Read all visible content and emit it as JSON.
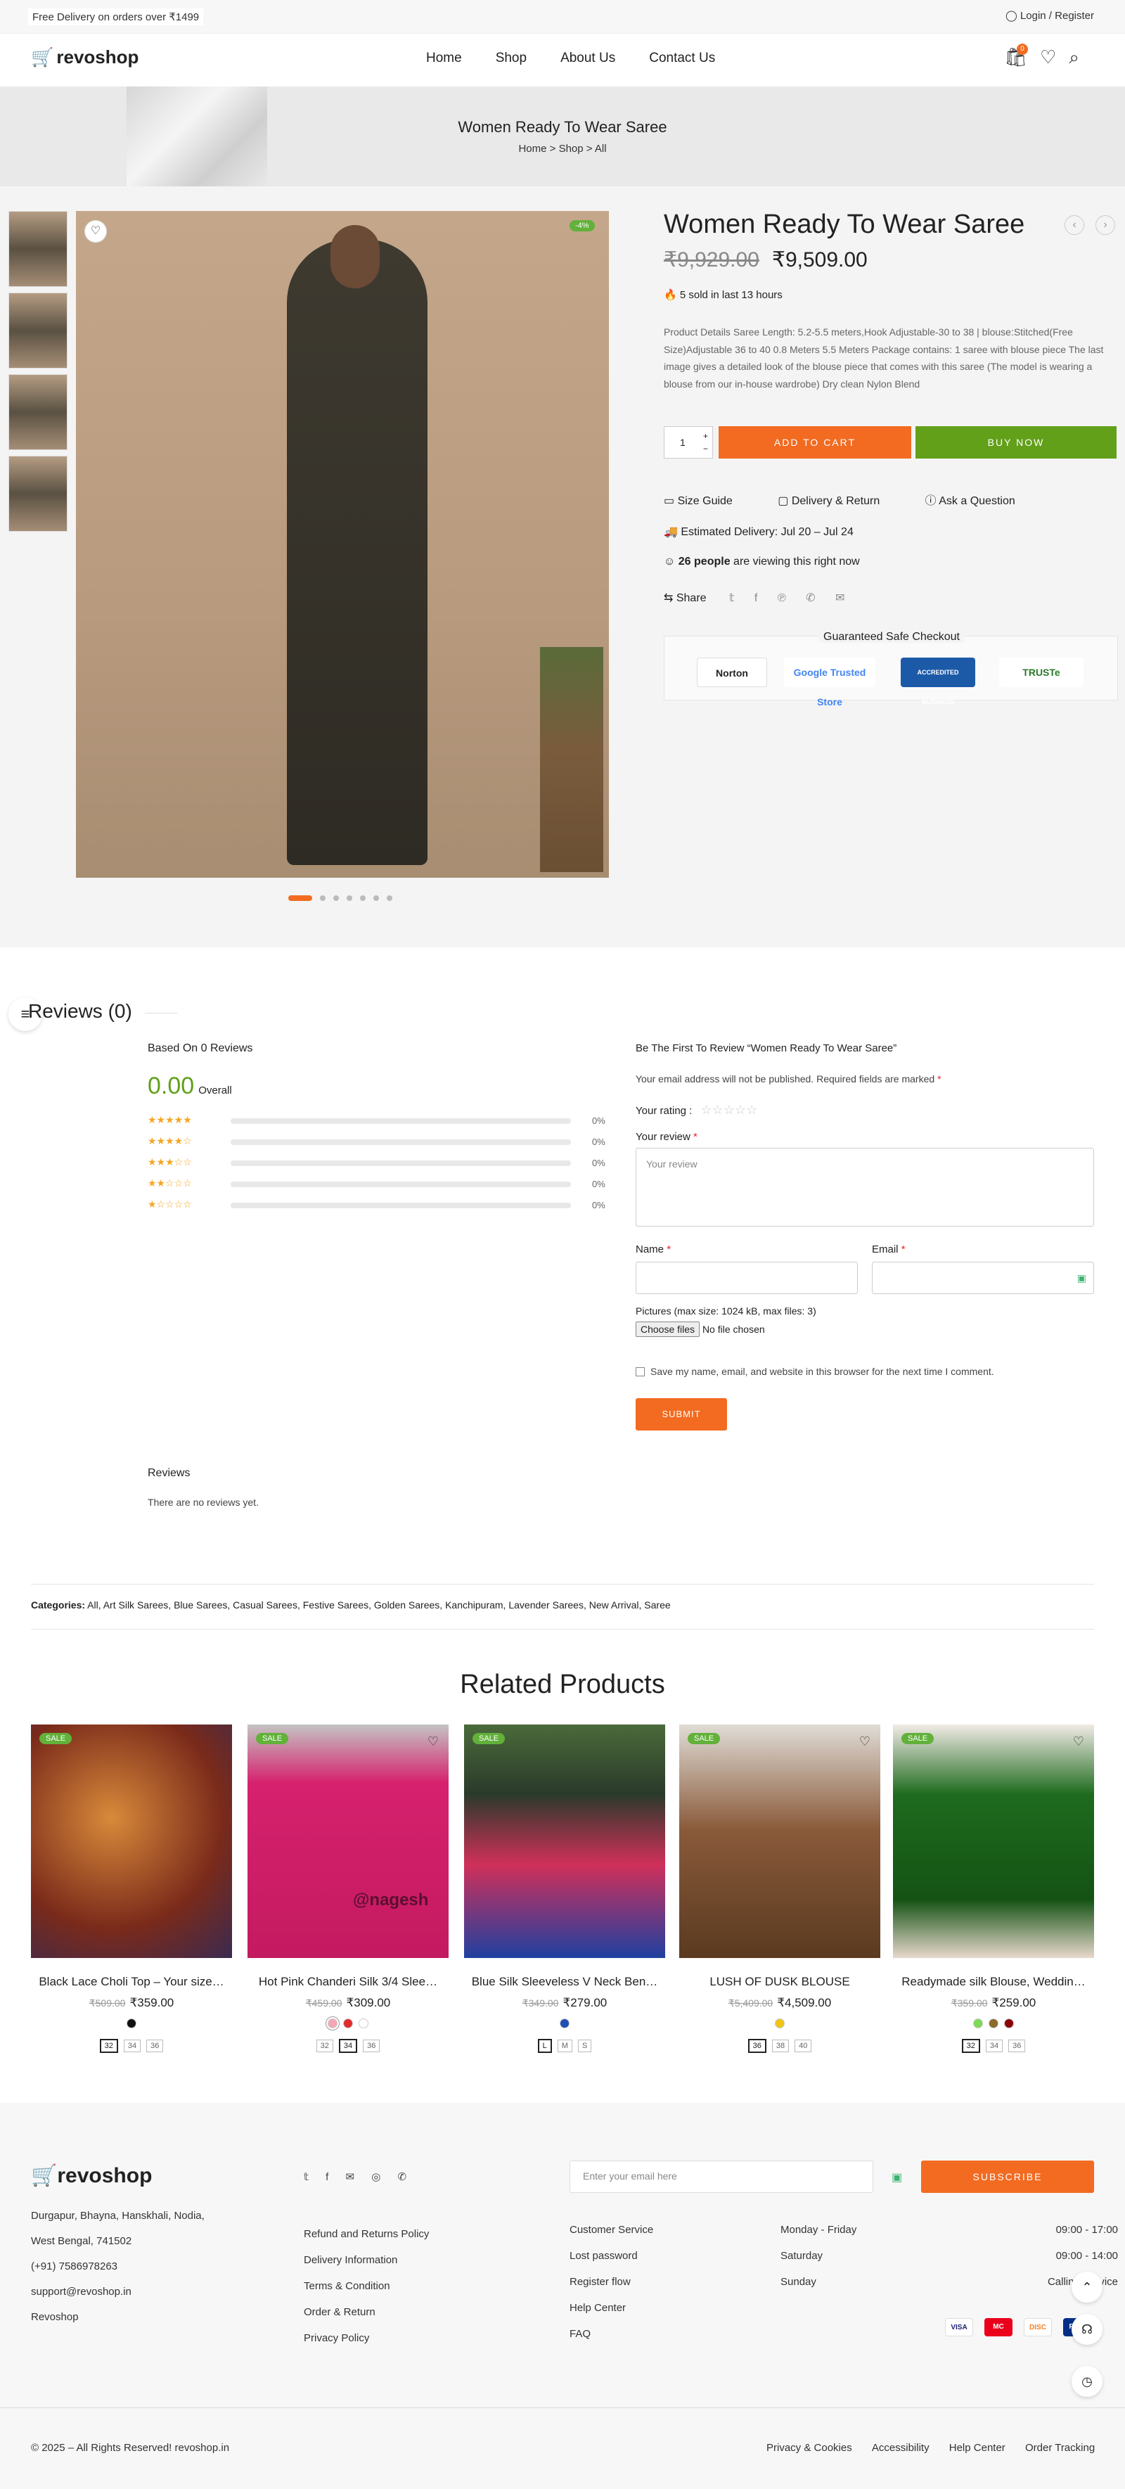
{
  "topbar": {
    "promo": "Free Delivery on orders over ₹1499",
    "login": "Login / Register"
  },
  "header": {
    "logo": "revoshop",
    "nav": [
      "Home",
      "Shop",
      "About Us",
      "Contact Us"
    ],
    "cart_count": "0",
    "icons": [
      "cart-icon",
      "heart-icon",
      "search-icon"
    ]
  },
  "banner": {
    "title": "Women Ready To Wear Saree",
    "crumbs": [
      "Home",
      ">",
      "Shop",
      ">",
      "All"
    ]
  },
  "product": {
    "discount": "-4%",
    "title": "Women Ready To Wear Saree",
    "old_price": "₹9,929.00",
    "price": "₹9,509.00",
    "sold": "5 sold in last 13 hours",
    "description": "Product Details Saree Length: 5.2-5.5 meters,Hook Adjustable-30 to 38 | blouse:Stitched(Free Size)Adjustable 36 to 40 0.8 Meters 5.5 Meters Package contains: 1 saree with blouse piece The last image gives a detailed look of the blouse piece that comes with this saree (The model is wearing a blouse from our in-house wardrobe) Dry clean Nylon Blend",
    "qty": "1",
    "add_to_cart": "ADD TO CART",
    "buy_now": "BUY NOW",
    "links": [
      "Size Guide",
      "Delivery & Return",
      "Ask a Question"
    ],
    "delivery_label": "Estimated Delivery:",
    "delivery_value": "Jul 20 – Jul 24",
    "viewing_count": "26 people",
    "viewing_text": "are viewing this right now",
    "share": "Share",
    "safe_checkout": "Guaranteed Safe Checkout",
    "trust_badges": [
      "Norton",
      "Google Trusted Store",
      "ACCREDITED BUSINESS",
      "TRUSTe"
    ]
  },
  "reviews": {
    "title": "Reviews (0)",
    "based_on": "Based On 0 Reviews",
    "average": "0.00",
    "overall": "Overall",
    "stars": [
      "★★★★★",
      "★★★★☆",
      "★★★☆☆",
      "★★☆☆☆",
      "★☆☆☆☆"
    ],
    "percents": [
      "0%",
      "0%",
      "0%",
      "0%",
      "0%"
    ],
    "form_title": "Be The First To Review “Women Ready To Wear Saree”",
    "notice": "Your email address will not be published. Required fields are marked",
    "rating_label": "Your rating :",
    "rating_stars": "☆☆☆☆☆",
    "review_label": "Your review",
    "review_placeholder": "Your review",
    "name_label": "Name",
    "email_label": "Email",
    "pictures_label": "Pictures (max size: 1024 kB, max files: 3)",
    "choose_files": "Choose files",
    "no_file": "No file chosen",
    "save_info": "Save my name, email, and website in this browser for the next time I comment.",
    "submit": "SUBMIT",
    "list_title": "Reviews",
    "empty": "There are no reviews yet."
  },
  "categories": {
    "label": "Categories:",
    "list": "All, Art Silk Sarees, Blue Sarees, Casual Sarees, Festive Sarees, Golden Sarees, Kanchipuram, Lavender Sarees, New Arrival, Saree"
  },
  "related": {
    "title": "Related Products",
    "items": [
      {
        "name": "Black Lace Choli Top – Your size…",
        "old": "₹509.00",
        "price": "₹359.00",
        "sale": "SALE",
        "sizes": [
          "32",
          "34",
          "36"
        ],
        "sel": 0,
        "swatches": [
          "#111111"
        ]
      },
      {
        "name": "Hot Pink Chanderi Silk 3/4 Slee…",
        "old": "₹459.00",
        "price": "₹309.00",
        "sale": "SALE",
        "sizes": [
          "32",
          "34",
          "36"
        ],
        "sel": 1,
        "swatches": [
          "#f4a6b8",
          "#e02c2c",
          "#ffffff"
        ],
        "watermark": "@nagesh"
      },
      {
        "name": "Blue Silk Sleeveless V Neck Ben…",
        "old": "₹349.00",
        "price": "₹279.00",
        "sale": "SALE",
        "sizes": [
          "L",
          "M",
          "S"
        ],
        "sel": 0,
        "swatches": [
          "#1f4fb5"
        ]
      },
      {
        "name": "LUSH OF DUSK BLOUSE",
        "old": "₹5,409.00",
        "price": "₹4,509.00",
        "sale": "SALE",
        "sizes": [
          "36",
          "38",
          "40"
        ],
        "sel": 0,
        "swatches": [
          "#f0c419"
        ]
      },
      {
        "name": "Readymade silk Blouse, Weddin…",
        "old": "₹359.00",
        "price": "₹259.00",
        "sale": "SALE",
        "sizes": [
          "32",
          "34",
          "36"
        ],
        "sel": 0,
        "swatches": [
          "#7ed957",
          "#8b6a2a",
          "#8b0000"
        ]
      }
    ]
  },
  "footer": {
    "logo": "revoshop",
    "address1": "Durgapur, Bhayna, Hanskhali, Nodia,",
    "address2": "West Bengal, 741502",
    "phone": "(+91) 7586978263",
    "email": "support@revoshop.in",
    "brand": "Revoshop",
    "policies": [
      "Refund and Returns Policy",
      "Delivery Information",
      "Terms & Condition",
      "Order & Return",
      "Privacy Policy"
    ],
    "service": [
      "Customer Service",
      "Lost password",
      "Register flow",
      "Help Center",
      "FAQ"
    ],
    "hours": [
      [
        "Monday - Friday",
        "09:00 - 17:00"
      ],
      [
        "Saturday",
        "09:00 - 14:00"
      ],
      [
        "Sunday",
        "Calling Service"
      ]
    ],
    "email_placeholder": "Enter your email here",
    "subscribe": "SUBSCRIBE",
    "payments": [
      "VISA",
      "MC",
      "DISC",
      "PP"
    ],
    "copyright": "© 2025 – All Rights Reserved! revoshop.in",
    "bottom_links": [
      "Privacy & Cookies",
      "Accessibility",
      "Help Center",
      "Order Tracking"
    ]
  }
}
